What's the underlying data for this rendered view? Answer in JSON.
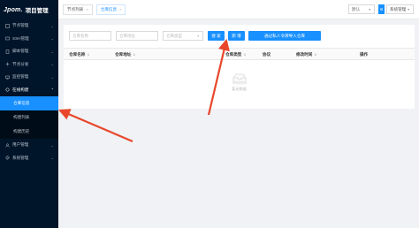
{
  "app": {
    "brand": "Jpom.",
    "title": "项目管理"
  },
  "sidebar": {
    "items": [
      {
        "label": "节点管理",
        "icon": "node-icon"
      },
      {
        "label": "SSH管理",
        "icon": "terminal-icon"
      },
      {
        "label": "脚本管理",
        "icon": "script-icon"
      },
      {
        "label": "节点分发",
        "icon": "distribute-icon"
      },
      {
        "label": "监控管理",
        "icon": "monitor-icon"
      },
      {
        "label": "在线构建",
        "icon": "build-icon"
      }
    ],
    "subitems": [
      {
        "label": "仓库信息",
        "active": true
      },
      {
        "label": "构建列表",
        "active": false
      },
      {
        "label": "构建历史",
        "active": false
      }
    ],
    "bottom_items": [
      {
        "label": "用户管理",
        "icon": "user-icon"
      },
      {
        "label": "系统管理",
        "icon": "settings-icon"
      }
    ]
  },
  "tabs": [
    {
      "label": "节点列表",
      "close": "×",
      "active": false
    },
    {
      "label": "仓库信息",
      "close": "×",
      "active": true
    }
  ],
  "topbar": {
    "workspace": "默认",
    "system_menu": "系统管理"
  },
  "toolbar": {
    "repo_name_placeholder": "仓库名称",
    "repo_address_placeholder": "仓库地址",
    "repo_type_placeholder": "仓库类型",
    "search_label": "搜 索",
    "add_label": "新 增",
    "import_label": "通过私人令牌导入仓库"
  },
  "table": {
    "columns": [
      "仓库名称",
      "仓库地址",
      "仓库类型",
      "协议",
      "修改时间",
      "操作"
    ],
    "empty_text": "暂无数据"
  },
  "colors": {
    "accent": "#1890ff",
    "sidebar_bg": "#00152a",
    "arrow": "#e8472c"
  }
}
